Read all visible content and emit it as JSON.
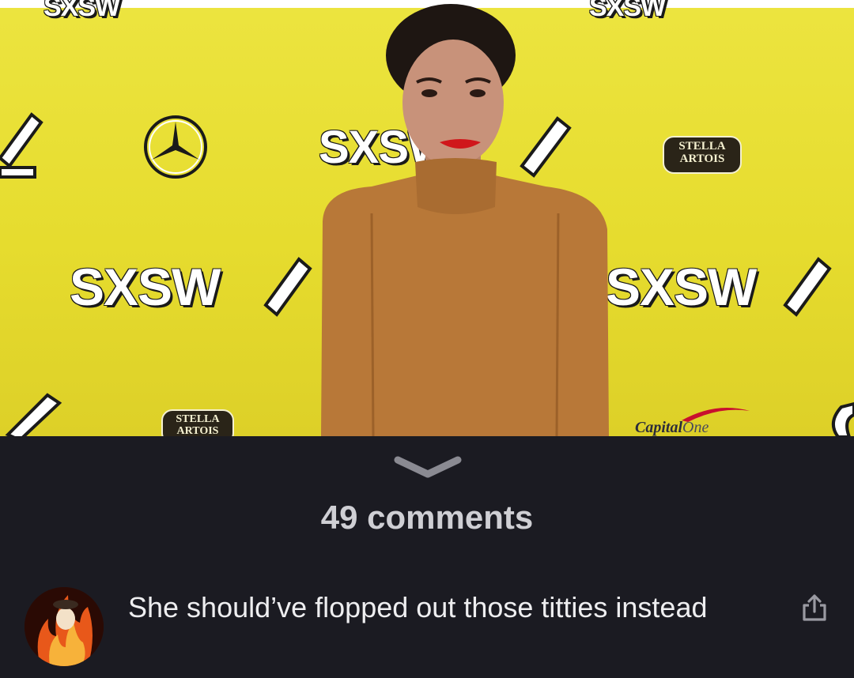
{
  "post": {
    "backdrop_texts": {
      "sxsw": "SXSW",
      "stella_line1": "STELLA",
      "stella_line2": "ARTOIS",
      "capital": "Capital",
      "one": "One"
    }
  },
  "comments": {
    "count_label": "49 comments"
  },
  "top_comment": {
    "text": "She should’ve flopped out those titties instead"
  },
  "icons": {
    "collapse": "chevron-down-icon",
    "share": "share-icon",
    "mercedes": "mercedes-logo-icon"
  },
  "colors": {
    "background": "#1b1b22",
    "backdrop_yellow": "#e6dc2e",
    "comment_text": "#eeeef0",
    "count_text": "#cfcfd4",
    "icon_gray": "#9a9aa2"
  }
}
